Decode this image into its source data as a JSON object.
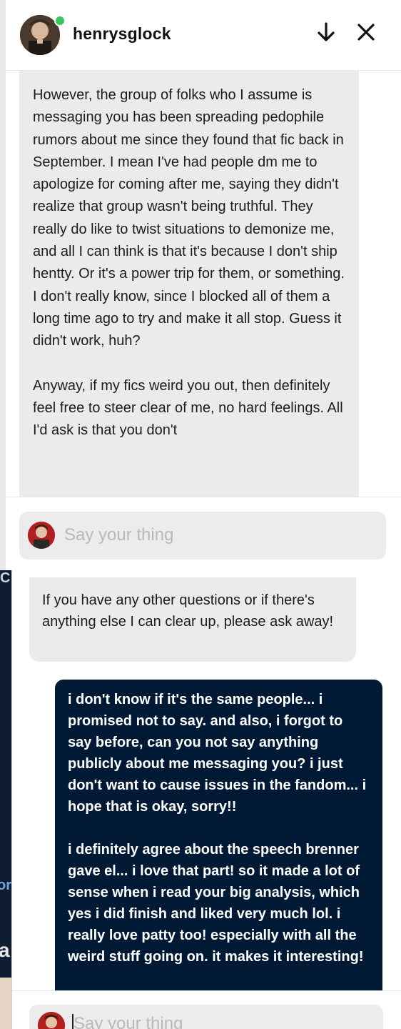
{
  "top_panel": {
    "header": {
      "blog_name": "henrysglock",
      "online_status_color": "#3fc55e",
      "icons": [
        "arrow-down-icon",
        "close-icon"
      ]
    },
    "message": {
      "paragraph_1": "However, the group of folks who I assume is messaging you has been spreading pedophile rumors about me since they found that fic back in September. I mean I've had people dm me to apologize for coming after me, saying they didn't realize that group wasn't being truthful. They really do like to twist situations to demonize me, and all I can think is that it's because I don't ship hentty. Or it's a power trip for them, or something. I don't really know, since I blocked all of them a long time ago to try and make it all stop. Guess it didn't work, huh?",
      "paragraph_2": "Anyway, if my fics weird you out, then definitely feel free to steer clear of me, no hard feelings. All I'd ask is that you don't"
    },
    "composer": {
      "placeholder": "Say your thing"
    }
  },
  "bottom_panel": {
    "background_fragments": {
      "top_letter": "C",
      "middle_text": "or",
      "lower_letter": "a"
    },
    "incoming_message": "If you have any other questions or if there's anything else I can clear up, please ask away!",
    "outgoing_message": {
      "paragraph_1": "i don't know if it's the same people... i promised not to say. and also, i forgot to say before, can you not say anything publicly about me messaging you? i just don't want to cause issues in the fandom... i hope that is okay, sorry!!",
      "paragraph_2": "i definitely agree about the speech brenner gave el... i love that part! so it made a lot of sense when i read your big analysis, which yes i did finish and liked very much lol. i really love patty too! especially with all the weird stuff going on. it makes it interesting!"
    },
    "composer": {
      "placeholder": "Say your thing"
    }
  },
  "colors": {
    "gray_bubble": "#ebebeb",
    "navy_bubble": "#001935",
    "placeholder": "#b9b9b9"
  }
}
